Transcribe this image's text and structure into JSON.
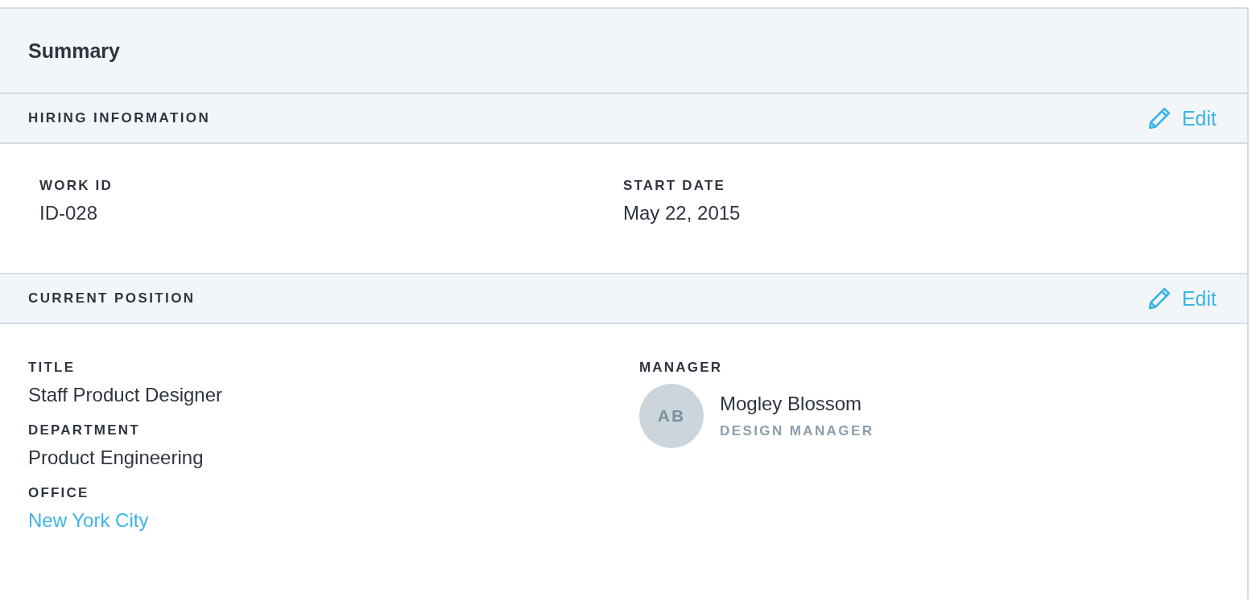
{
  "title": "Summary",
  "sections": [
    {
      "heading": "HIRING INFORMATION",
      "action": "Edit",
      "columns": [
        [
          {
            "kind": "text",
            "label": "WORK ID",
            "value": "ID-028"
          }
        ],
        [
          {
            "kind": "text",
            "label": "START DATE",
            "value": "May 22, 2015"
          }
        ]
      ]
    },
    {
      "heading": "CURRENT POSITION",
      "action": "Edit",
      "columns": [
        [
          {
            "kind": "text",
            "label": "TITLE",
            "value": "Staff Product Designer"
          },
          {
            "kind": "text",
            "label": "DEPARTMENT",
            "value": "Product Engineering"
          },
          {
            "kind": "link",
            "label": "OFFICE",
            "value": "New York City"
          }
        ],
        [
          {
            "kind": "person",
            "label": "MANAGER",
            "initials": "AB",
            "name": "Mogley Blossom",
            "role": "DESIGN MANAGER"
          }
        ]
      ]
    }
  ]
}
